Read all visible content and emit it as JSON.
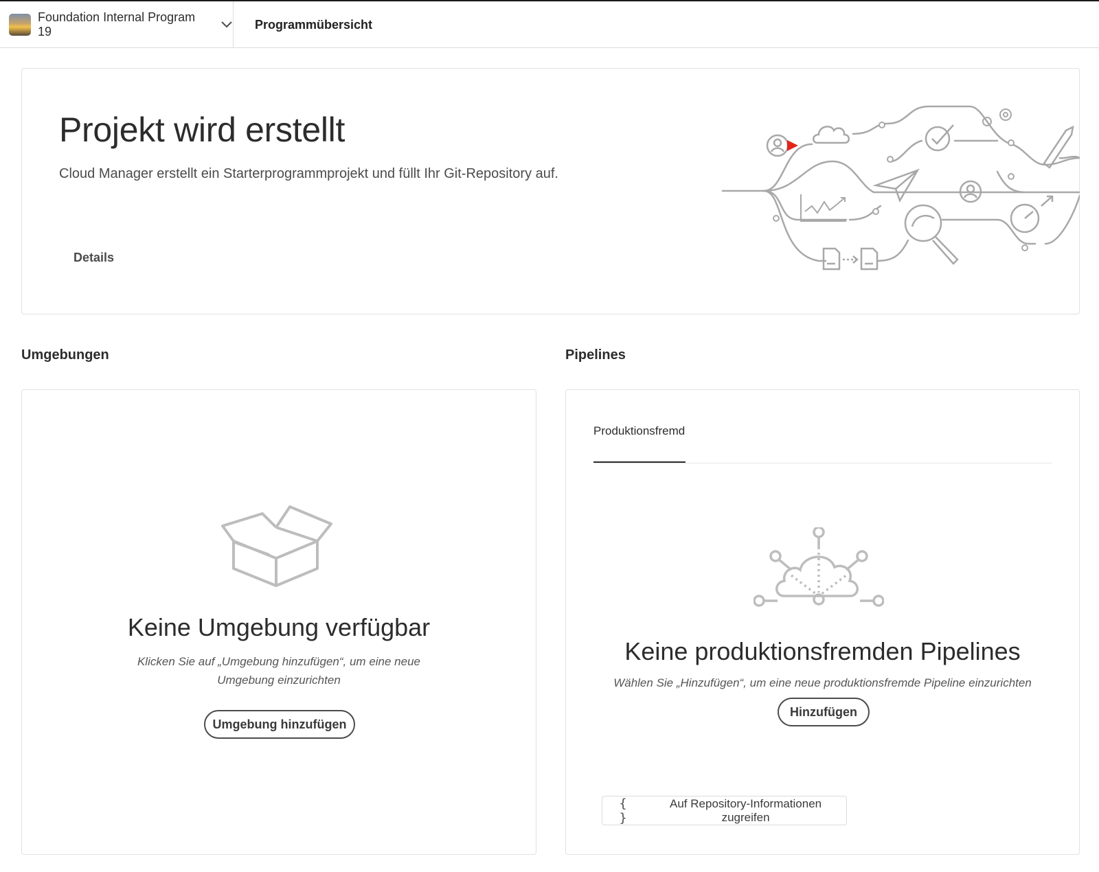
{
  "topbar": {
    "program_name": "Foundation Internal Program 19",
    "page_title": "Programmübersicht"
  },
  "hero": {
    "title": "Projekt wird erstellt",
    "description": "Cloud Manager erstellt ein Starterprogrammprojekt und füllt Ihr Git-Repository auf.",
    "details_label": "Details"
  },
  "environments": {
    "section_title": "Umgebungen",
    "empty_title": "Keine Umgebung verfügbar",
    "empty_desc_line1": "Klicken Sie auf „Umgebung hinzufügen“, um eine neue",
    "empty_desc_line2": "Umgebung einzurichten",
    "add_button": "Umgebung hinzufügen"
  },
  "pipelines": {
    "section_title": "Pipelines",
    "tab_label": "Produktionsfremd",
    "empty_title": "Keine produktionsfremden Pipelines",
    "empty_desc": "Wählen Sie „Hinzufügen“, um eine neue produktionsfremde Pipeline einzurichten",
    "add_button": "Hinzufügen",
    "repo_button": "Auf Repository-Informationen zugreifen",
    "repo_icon": "{ }"
  },
  "colors": {
    "accent_red": "#e1251b",
    "illustration_gray": "#a8a8a8"
  }
}
